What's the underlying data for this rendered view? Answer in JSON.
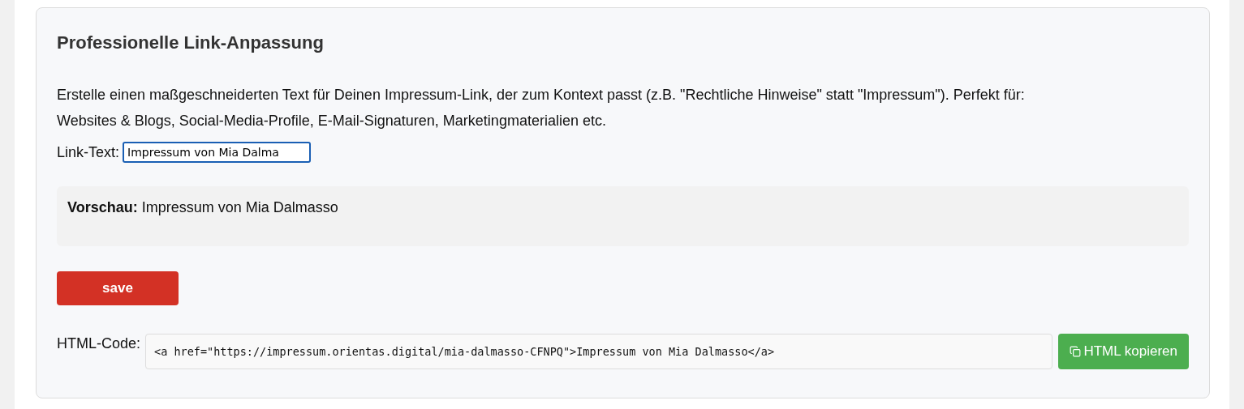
{
  "card": {
    "title": "Professionelle Link-Anpassung",
    "description": "Erstelle einen maßgeschneiderten Text für Deinen Impressum-Link, der zum Kontext passt (z.B. \"Rechtliche Hinweise\" statt \"Impressum\"). Perfekt für: Websites & Blogs, Social-Media-Profile, E-Mail-Signaturen, Marketingmaterialien etc.",
    "link_text": {
      "label": "Link-Text:",
      "value": "Impressum von Mia Dalma",
      "focused": true
    },
    "preview": {
      "label": "Vorschau:",
      "text": "Impressum von Mia Dalmasso"
    },
    "save_button": "save",
    "html_code": {
      "label": "HTML-Code:",
      "code": "<a href=\"https://impressum.orientas.digital/mia-dalmasso-CFNPQ\">Impressum von Mia Dalmasso</a>",
      "copy_button": "HTML kopieren"
    }
  }
}
